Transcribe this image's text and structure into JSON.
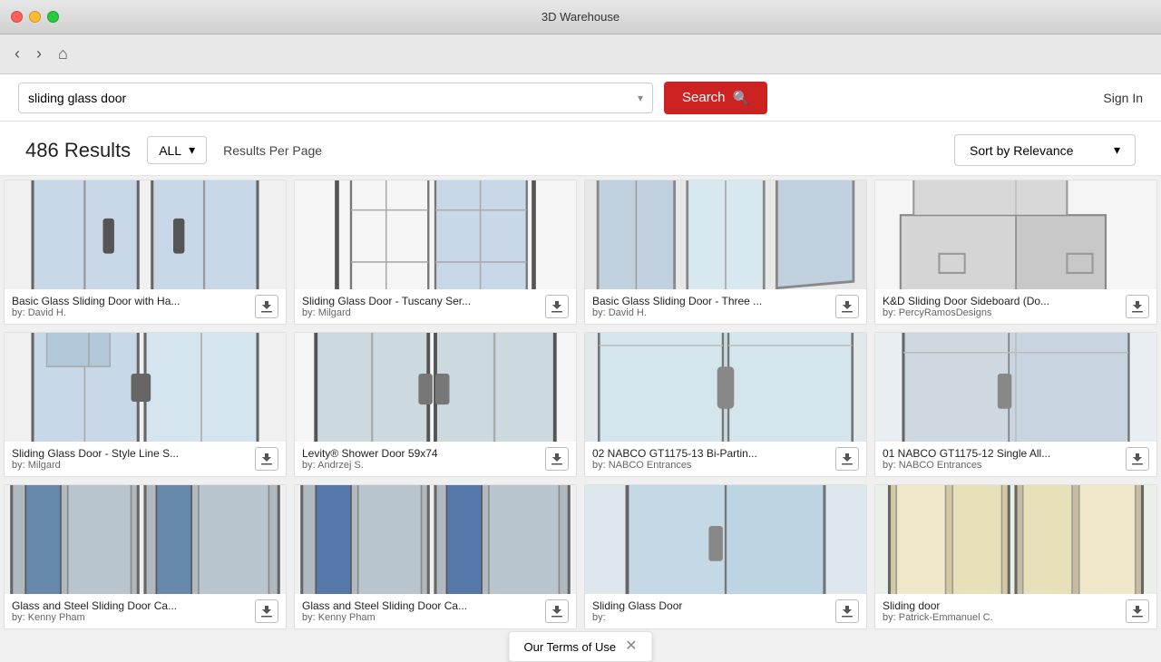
{
  "app": {
    "title": "3D Warehouse"
  },
  "titlebar": {
    "close_btn": "×",
    "min_btn": "−",
    "max_btn": "+"
  },
  "navbar": {
    "back_label": "‹",
    "forward_label": "›",
    "home_label": "⌂"
  },
  "searchbar": {
    "query": "sliding glass door",
    "dropdown_placeholder": "▾",
    "search_button_label": "Search",
    "sign_in_label": "Sign In"
  },
  "results": {
    "count_label": "486 Results",
    "filter_label": "ALL",
    "per_page_label": "Results Per Page",
    "sort_label": "Sort by Relevance"
  },
  "items": [
    {
      "title": "Basic Glass Sliding Door with Ha...",
      "author": "by: David H.",
      "thumb_type": "double_glass_door"
    },
    {
      "title": "Sliding Glass Door - Tuscany Ser...",
      "author": "by: Milgard",
      "thumb_type": "grid_door"
    },
    {
      "title": "Basic Glass Sliding Door - Three ...",
      "author": "by: David H.",
      "thumb_type": "three_panel_door"
    },
    {
      "title": "K&D Sliding Door Sideboard (Do...",
      "author": "by: PercyRamosDesigns",
      "thumb_type": "sideboard"
    },
    {
      "title": "Sliding Glass Door - Style Line S...",
      "author": "by: Milgard",
      "thumb_type": "style_line_door"
    },
    {
      "title": "Levity® Shower Door 59x74",
      "author": "by: Andrzej S.",
      "thumb_type": "shower_door"
    },
    {
      "title": "02 NABCO GT1175-13 Bi-Partin...",
      "author": "by: NABCO Entrances",
      "thumb_type": "nabco_bi"
    },
    {
      "title": "01 NABCO GT1175-12 Single All...",
      "author": "by: NABCO Entrances",
      "thumb_type": "nabco_single"
    },
    {
      "title": "Glass and Steel Sliding Door Ca...",
      "author": "by: Kenny Pham",
      "thumb_type": "steel_door_1"
    },
    {
      "title": "Glass and Steel Sliding Door Ca...",
      "author": "by: Kenny Pham",
      "thumb_type": "steel_door_2"
    },
    {
      "title": "Sliding Glass Door",
      "author": "by:",
      "thumb_type": "simple_glass_door"
    },
    {
      "title": "Sliding door",
      "author": "by: Patrick-Emmanuel C.",
      "thumb_type": "sliding_door_wood"
    }
  ],
  "terms": {
    "label": "Our Terms of Use",
    "close_icon": "✕"
  }
}
